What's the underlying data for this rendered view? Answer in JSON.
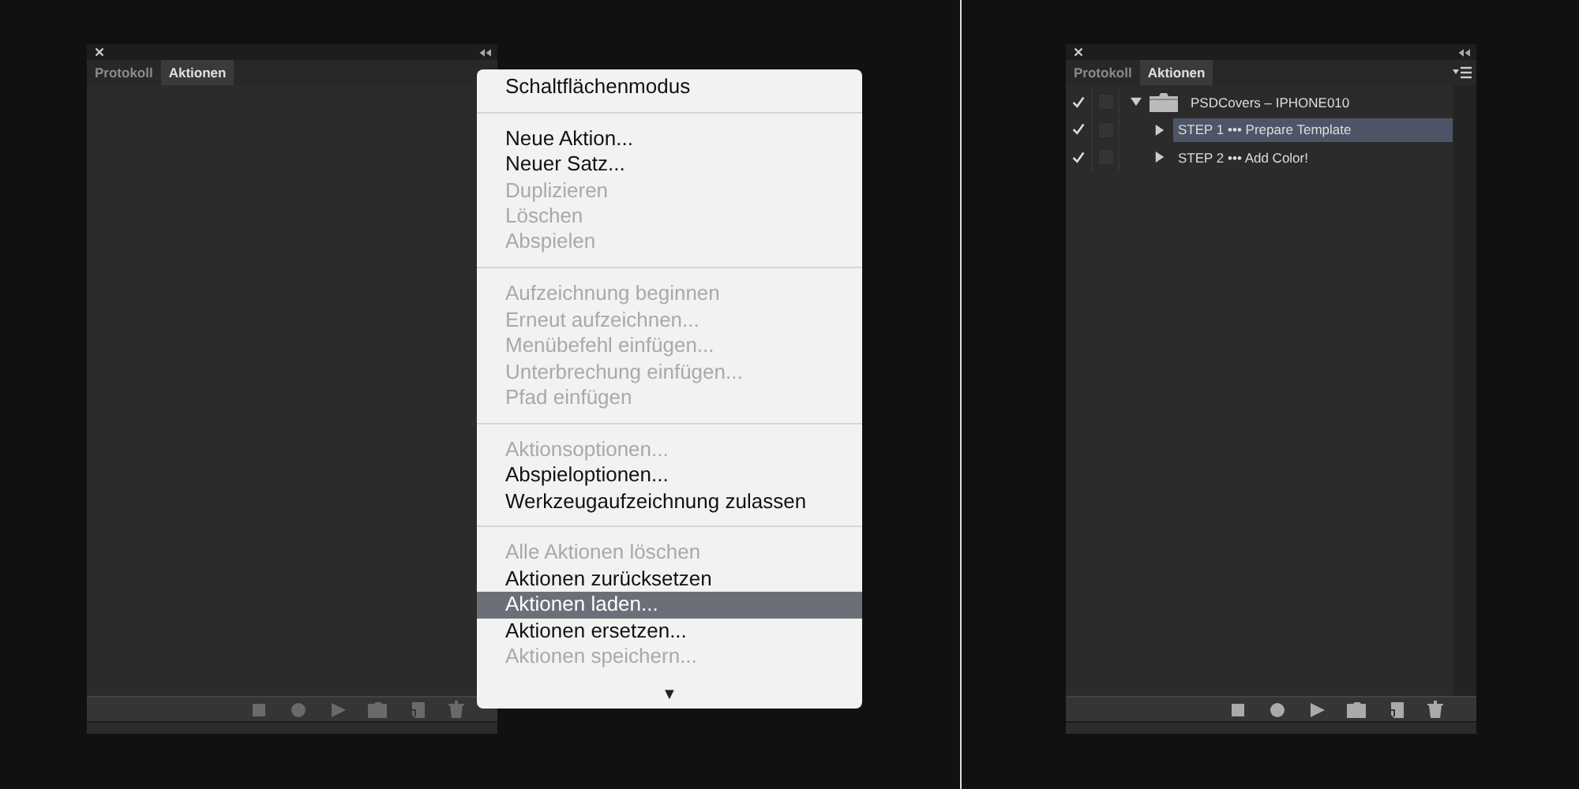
{
  "left_panel": {
    "tabs": [
      {
        "label": "Protokoll",
        "selected": false
      },
      {
        "label": "Aktionen",
        "selected": true
      }
    ],
    "toolbar": {
      "disabled": true
    }
  },
  "flyout_menu": {
    "items": [
      {
        "kind": "item",
        "label": "Schaltflächenmodus",
        "disabled": false,
        "selected": false
      },
      {
        "kind": "separator"
      },
      {
        "kind": "item",
        "label": "Neue Aktion...",
        "disabled": false,
        "selected": false
      },
      {
        "kind": "item",
        "label": "Neuer Satz...",
        "disabled": false,
        "selected": false
      },
      {
        "kind": "item",
        "label": "Duplizieren",
        "disabled": true,
        "selected": false
      },
      {
        "kind": "item",
        "label": "Löschen",
        "disabled": true,
        "selected": false
      },
      {
        "kind": "item",
        "label": "Abspielen",
        "disabled": true,
        "selected": false
      },
      {
        "kind": "separator"
      },
      {
        "kind": "item",
        "label": "Aufzeichnung beginnen",
        "disabled": true,
        "selected": false
      },
      {
        "kind": "item",
        "label": "Erneut aufzeichnen...",
        "disabled": true,
        "selected": false
      },
      {
        "kind": "item",
        "label": "Menübefehl einfügen...",
        "disabled": true,
        "selected": false
      },
      {
        "kind": "item",
        "label": "Unterbrechung einfügen...",
        "disabled": true,
        "selected": false
      },
      {
        "kind": "item",
        "label": "Pfad einfügen",
        "disabled": true,
        "selected": false
      },
      {
        "kind": "separator"
      },
      {
        "kind": "item",
        "label": "Aktionsoptionen...",
        "disabled": true,
        "selected": false
      },
      {
        "kind": "item",
        "label": "Abspieloptionen...",
        "disabled": false,
        "selected": false
      },
      {
        "kind": "item",
        "label": "Werkzeugaufzeichnung zulassen",
        "disabled": false,
        "selected": false
      },
      {
        "kind": "separator"
      },
      {
        "kind": "item",
        "label": "Alle Aktionen löschen",
        "disabled": true,
        "selected": false
      },
      {
        "kind": "item",
        "label": "Aktionen zurücksetzen",
        "disabled": false,
        "selected": false
      },
      {
        "kind": "item",
        "label": "Aktionen laden...",
        "disabled": false,
        "selected": true
      },
      {
        "kind": "item",
        "label": "Aktionen ersetzen...",
        "disabled": false,
        "selected": false
      },
      {
        "kind": "item",
        "label": "Aktionen speichern...",
        "disabled": true,
        "selected": false
      }
    ],
    "scroll_arrow": "▼"
  },
  "right_panel": {
    "tabs": [
      {
        "label": "Protokoll",
        "selected": false
      },
      {
        "label": "Aktionen",
        "selected": true
      }
    ],
    "action_set": {
      "name": "PSDCovers – IPHONE010",
      "checked": true,
      "dialog": false,
      "expanded": true,
      "selected": false,
      "children": [
        {
          "name": "STEP 1 ••• Prepare Template",
          "checked": true,
          "dialog": false,
          "expanded": false,
          "selected": true
        },
        {
          "name": "STEP 2 ••• Add Color!",
          "checked": true,
          "dialog": false,
          "expanded": false,
          "selected": false
        }
      ]
    },
    "toolbar": {
      "disabled": false
    }
  }
}
